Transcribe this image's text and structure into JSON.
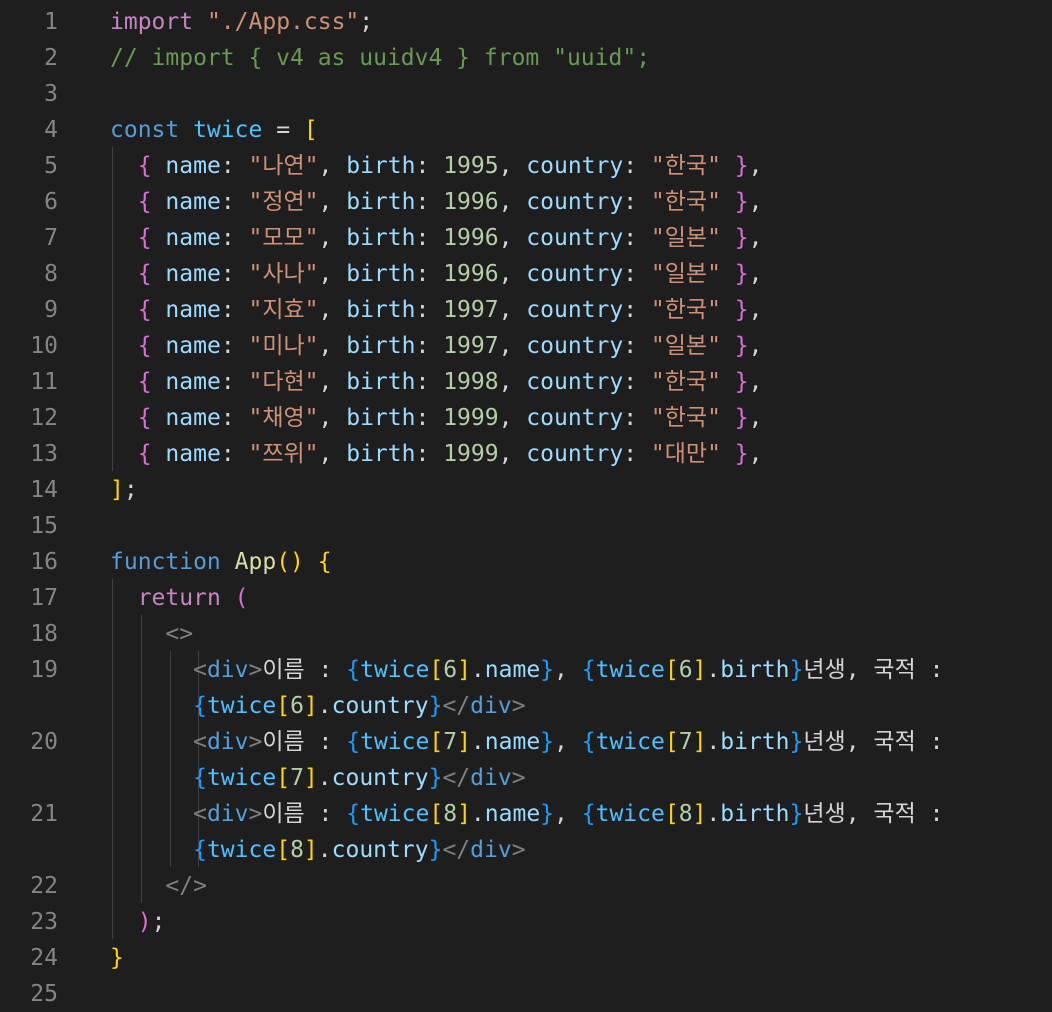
{
  "editor": {
    "line_numbers": [
      "1",
      "2",
      "3",
      "4",
      "5",
      "6",
      "7",
      "8",
      "9",
      "10",
      "11",
      "12",
      "13",
      "14",
      "15",
      "16",
      "17",
      "18",
      "19",
      "20",
      "21",
      "22",
      "23",
      "24",
      "25"
    ],
    "line1": {
      "kw": "import",
      "str": "\"./App.css\"",
      "end": ";"
    },
    "line2": {
      "comment": "// import { v4 as uuidv4 } from \"uuid\";"
    },
    "line4": {
      "kw": "const",
      "name": "twice",
      "eq": " = ",
      "open": "["
    },
    "labels": {
      "name": "name",
      "birth": "birth",
      "country": "country"
    },
    "members": [
      {
        "name": "\"나연\"",
        "birth": "1995",
        "country": "\"한국\""
      },
      {
        "name": "\"정연\"",
        "birth": "1996",
        "country": "\"한국\""
      },
      {
        "name": "\"모모\"",
        "birth": "1996",
        "country": "\"일본\""
      },
      {
        "name": "\"사나\"",
        "birth": "1996",
        "country": "\"일본\""
      },
      {
        "name": "\"지효\"",
        "birth": "1997",
        "country": "\"한국\""
      },
      {
        "name": "\"미나\"",
        "birth": "1997",
        "country": "\"일본\""
      },
      {
        "name": "\"다현\"",
        "birth": "1998",
        "country": "\"한국\""
      },
      {
        "name": "\"채영\"",
        "birth": "1999",
        "country": "\"한국\""
      },
      {
        "name": "\"쯔위\"",
        "birth": "1999",
        "country": "\"대만\""
      }
    ],
    "line14": {
      "close": "]",
      "end": ";"
    },
    "line16": {
      "kw": "function",
      "fn": "App",
      "parens": "()",
      "brace": "{"
    },
    "line17": {
      "kw": "return",
      "paren": "("
    },
    "line18": {
      "frag": "<>"
    },
    "jsx_rows": [
      {
        "index": "6"
      },
      {
        "index": "7"
      },
      {
        "index": "8"
      }
    ],
    "jsx": {
      "tag": "div",
      "label_name": "이름 : ",
      "label_birth": "년생, 국적 :",
      "var": "twice",
      "prop_name": "name",
      "prop_birth": "birth",
      "prop_country": "country"
    },
    "line22": {
      "frag": "</>"
    },
    "line23": {
      "close": ")",
      "end": ";"
    },
    "line24": {
      "brace": "}"
    }
  }
}
